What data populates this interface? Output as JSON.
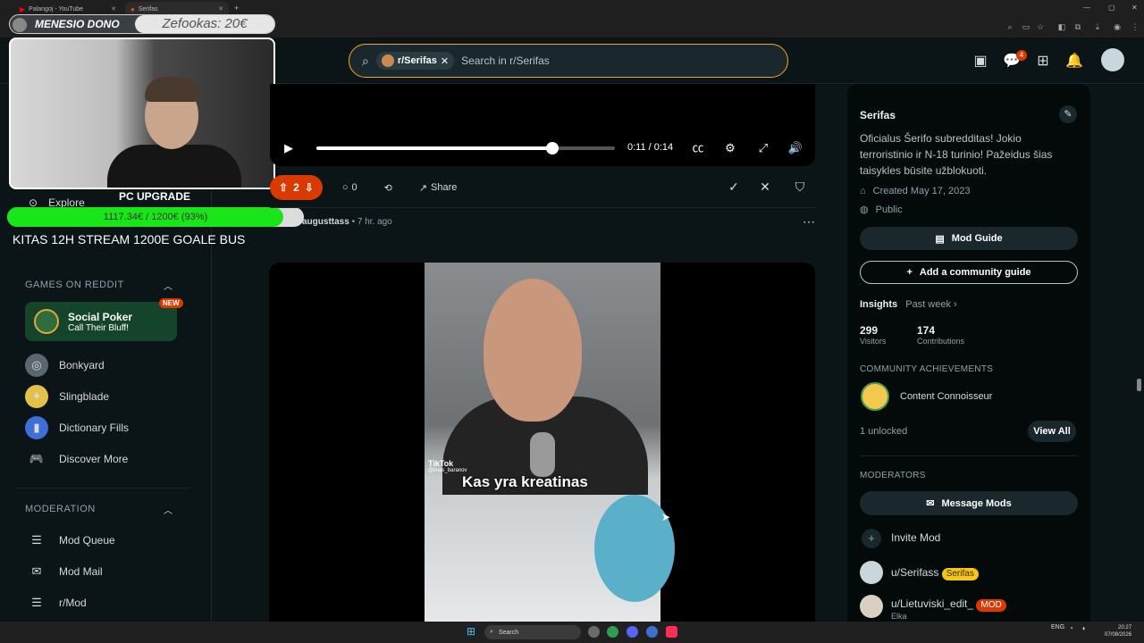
{
  "browser": {
    "tabs": [
      {
        "title": "Palangoj - YouTube"
      },
      {
        "title": "Serifas"
      }
    ],
    "new_tab_symbol": "+"
  },
  "header": {
    "search": {
      "chip_label": "r/Serifas",
      "placeholder": "Search in r/Serifas"
    },
    "chat_badge": "4",
    "icons": [
      "advertise-icon",
      "chat-icon",
      "create-icon",
      "notification-icon",
      "avatar"
    ]
  },
  "overlay": {
    "dono_label": "MENESIO DONO",
    "dono_value": "Zefookas: 20€",
    "goal_title": "PC UPGRADE",
    "goal_progress_text": "1117.34€ / 1200€ (93%)",
    "goal_fraction": 0.93,
    "stream_text": "KITAS 12H STREAM 1200E GOALE BUS"
  },
  "sidebar": {
    "explore_label": "Explore",
    "games_title": "GAMES ON REDDIT",
    "featured_game": {
      "title": "Social Poker",
      "subtitle": "Call Their Bluff!",
      "badge": "NEW"
    },
    "games": [
      {
        "label": "Bonkyard",
        "icon": "bonkyard-icon"
      },
      {
        "label": "Slingblade",
        "icon": "slingblade-icon"
      },
      {
        "label": "Dictionary Fills",
        "icon": "dictionary-icon"
      },
      {
        "label": "Discover More",
        "icon": "gamepad-icon"
      }
    ],
    "moderation_title": "MODERATION",
    "moderation": [
      {
        "label": "Mod Queue",
        "icon": "queue-icon"
      },
      {
        "label": "Mod Mail",
        "icon": "mail-icon"
      },
      {
        "label": "r/Mod",
        "icon": "mod-icon"
      }
    ]
  },
  "video_player": {
    "time": "0:11 / 0:14",
    "progress_fraction": 0.79,
    "controls": [
      "play-icon",
      "captions-icon",
      "settings-icon",
      "fullscreen-icon",
      "volume-icon"
    ]
  },
  "post_actions": {
    "votes": "2",
    "comments": "0",
    "share_label": "Share"
  },
  "next_post": {
    "author": "augusttass",
    "time": "7 hr. ago",
    "caption": "Kas yra kreatinas",
    "watermark": "TikTok",
    "watermark_user": "@linas_baranov"
  },
  "right_panel": {
    "sub_name": "Serifas",
    "description": "Oficialus Šerifo subredditas! Jokio terroristinio ir N-18 turinio! Pažeidus šias taisykles būsite užblokuoti.",
    "created": "Created May 17, 2023",
    "visibility": "Public",
    "mod_guide_label": "Mod Guide",
    "add_guide_label": "Add a community guide",
    "insights_label": "Insights",
    "insights_period": "Past week",
    "visitors": "299",
    "visitors_label": "Visitors",
    "contributions": "174",
    "contributions_label": "Contributions",
    "achievements_title": "COMMUNITY ACHIEVEMENTS",
    "achievement": "Content Connoisseur",
    "unlocked": "1 unlocked",
    "view_all": "View All",
    "moderators_title": "MODERATORS",
    "message_mods": "Message Mods",
    "invite_mod": "Invite Mod",
    "mods": [
      {
        "name": "u/Serifass",
        "flair": "Serifas",
        "flair_color": "#f5c518"
      },
      {
        "name": "u/Lietuviski_edit_",
        "flair": "MOD",
        "flair_color": "#d93a00",
        "sub": "Elka"
      }
    ]
  },
  "taskbar": {
    "search_label": "Search",
    "lang": "ENG",
    "time": "20:27",
    "date": "07/08/2026"
  },
  "colors": {
    "background": "#0b1416",
    "upvote": "#d93a00",
    "search_border": "#f5a623",
    "progress_green": "#19e619"
  }
}
